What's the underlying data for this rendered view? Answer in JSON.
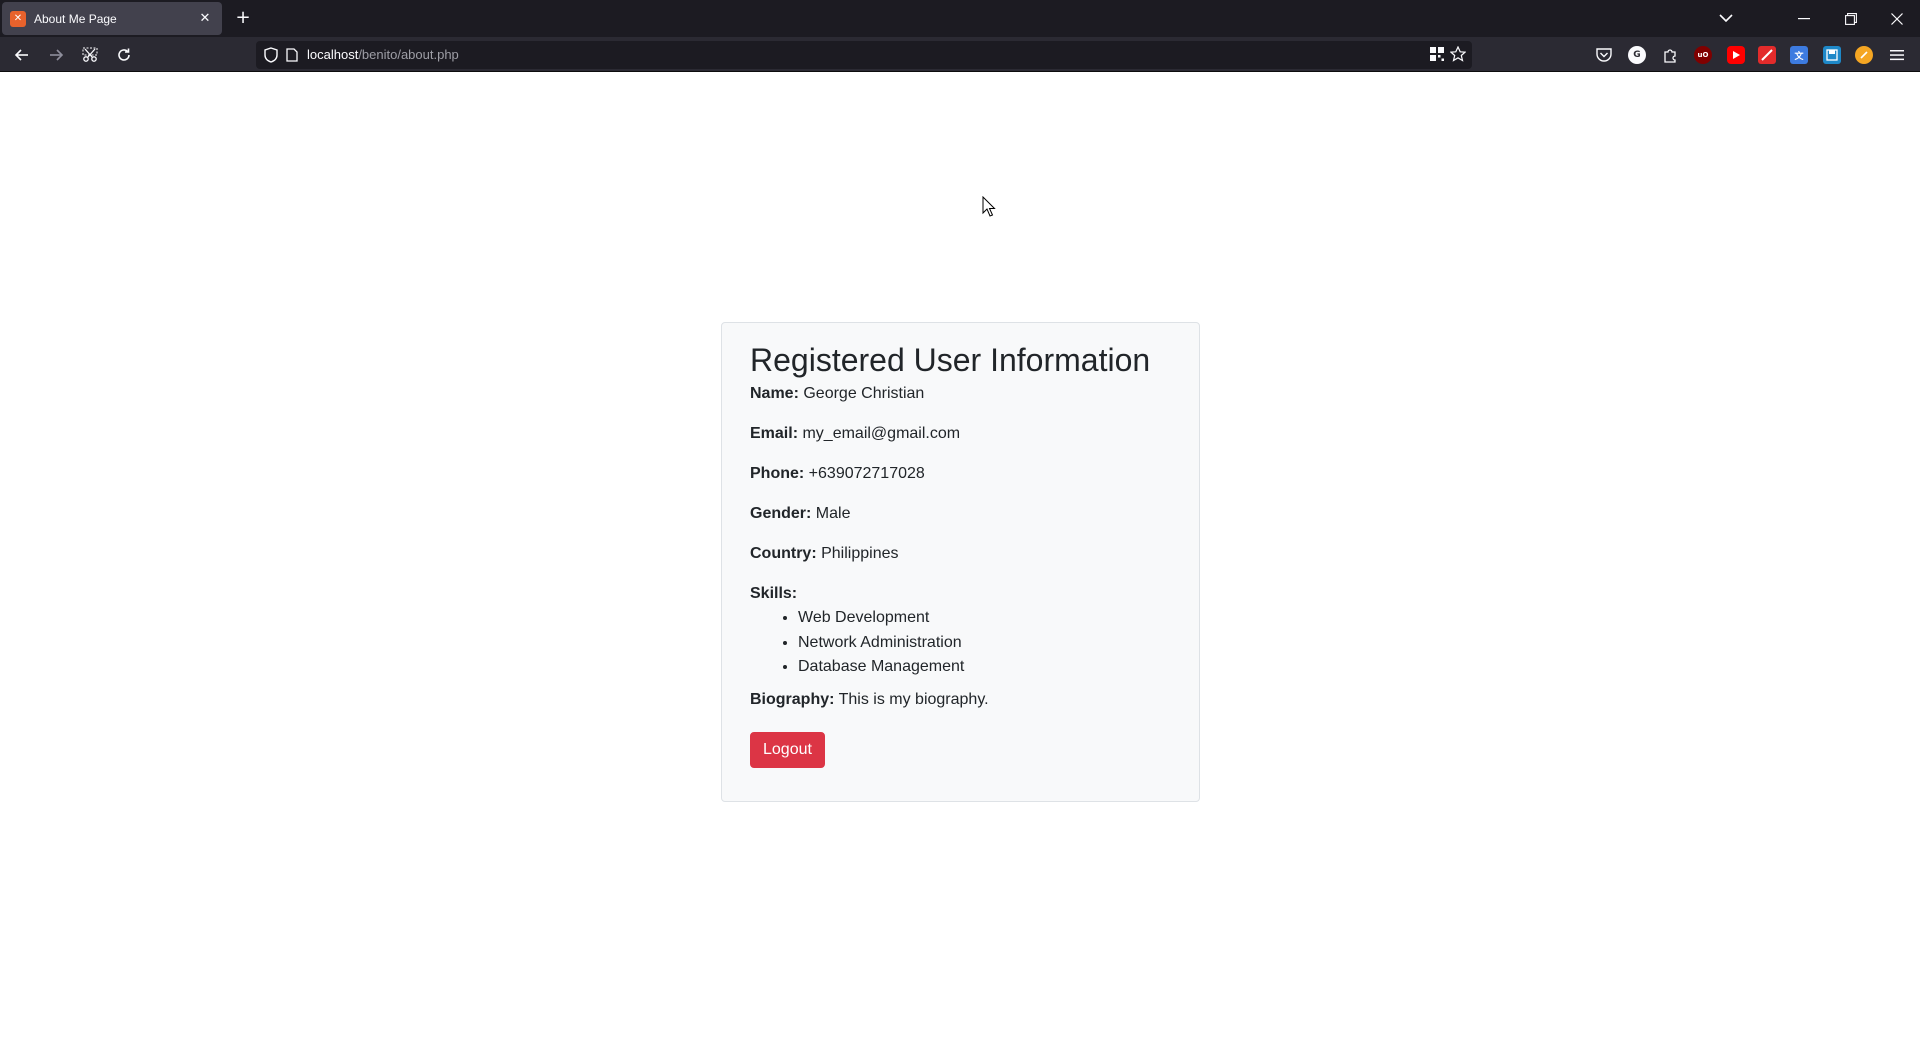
{
  "browser": {
    "tab_title": "About Me Page",
    "tab_favicon": "xampp-icon",
    "url_host": "localhost",
    "url_path": "/benito/about.php"
  },
  "page": {
    "heading": "Registered User Information",
    "fields": {
      "name_label": "Name:",
      "name_value": "George Christian",
      "email_label": "Email:",
      "email_value": "my_email@gmail.com",
      "phone_label": "Phone:",
      "phone_value": "+639072717028",
      "gender_label": "Gender:",
      "gender_value": "Male",
      "country_label": "Country:",
      "country_value": "Philippines",
      "skills_label": "Skills:",
      "biography_label": "Biography:",
      "biography_value": "This is my biography."
    },
    "skills": [
      "Web Development",
      "Network Administration",
      "Database Management"
    ],
    "logout_label": "Logout"
  },
  "colors": {
    "danger": "#dc3545",
    "card_bg": "#f8f9fa",
    "chrome_dark": "#1c1b22"
  }
}
